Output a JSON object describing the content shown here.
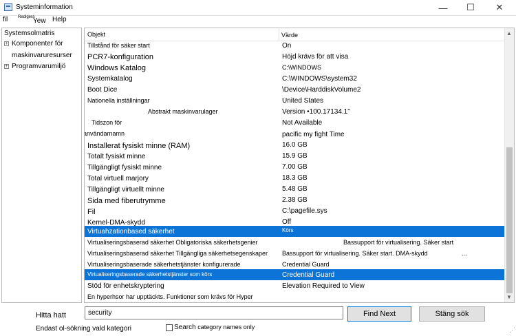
{
  "window": {
    "title": "Systeminformation",
    "minimize_glyph": "—",
    "maximize_glyph": "☐",
    "close_glyph": "✕"
  },
  "menu": {
    "file": "fil",
    "edit": "Redigera",
    "view": "Yew",
    "help": "Help"
  },
  "tree": {
    "root": "Systemsolmatris",
    "items": [
      "Komponenter för",
      "maskinvaruresurser",
      "Programvarumiljö"
    ]
  },
  "table": {
    "headers": {
      "item": "Objekt",
      "value": "Värde"
    },
    "rows": [
      {
        "item": "Tillstånd för säker start",
        "value": "On",
        "selected": false
      },
      {
        "item": "PCR7-konfiguration",
        "value": "Höjd krävs för att visa",
        "selected": false
      },
      {
        "item": "Windows Katalog",
        "value": "C:\\WINDOWS",
        "selected": false
      },
      {
        "item": "Systemkatalog",
        "value": "C:\\WINDOWS\\system32",
        "selected": false
      },
      {
        "item": "Boot Dice",
        "value": "\\Device\\HarddiskVolume2",
        "selected": false
      },
      {
        "item": "Nationella inställningar",
        "value": "United States",
        "selected": false
      },
      {
        "item": "Abstrakt maskinvarulager",
        "value": "Version •100.17134.1\"",
        "selected": false
      },
      {
        "item": "Tidszon för",
        "value": "Not Available",
        "selected": false
      },
      {
        "item": "användarnamn",
        "value": "pacific my fight Time",
        "selected": false
      },
      {
        "item": "Installerat fysiskt minne (RAM)",
        "value": "16.0 GB",
        "selected": false
      },
      {
        "item": "Totalt fysiskt minne",
        "value": "15.9 GB",
        "selected": false
      },
      {
        "item": "Tillgängligt fysiskt minne",
        "value": "7.00 GB",
        "selected": false
      },
      {
        "item": "Total virtuell marjory",
        "value": "18.3 GB",
        "selected": false
      },
      {
        "item": "Tillgängligt virtuellt minne",
        "value": "5.48 GB",
        "selected": false
      },
      {
        "item": "Sida med fiberutrymme",
        "value": "2.38 GB",
        "selected": false
      },
      {
        "item": "Fil",
        "value": "C:\\pagefile.sys",
        "selected": false
      },
      {
        "item": "Kernel-DMA-skydd",
        "value": "Off",
        "selected": false
      },
      {
        "item": "Virtuahzationbased säkerhet",
        "value": "Körs",
        "selected": true
      },
      {
        "item": "Virtualiseringsbaserad säkerhet Obligatoriska säkerhetsgenier",
        "value": "Bassupport för virtualisering. Säker start",
        "selected": false
      },
      {
        "item": "Virtualiseringsbaserad säkerhet Tillgängliga säkerhetsegenskaper",
        "value": "Bassupport för virtualisering. Säker start. DMA-skydd",
        "selected": false
      },
      {
        "item": "Virtualiseringsbaserade säkerhetstjänster konfigurerade",
        "value": "Credential Guard",
        "selected": false
      },
      {
        "item": "Virtualiseringsbaserade säkerhetstjänster som körs",
        "value": "Credential Guard",
        "selected": true
      },
      {
        "item": "Stöd för enhetskryptering",
        "value": "Elevation Required to View",
        "selected": false
      },
      {
        "item": "En hyperhsor har upptäckts. Funktioner som krävs för Hyper",
        "value": "",
        "selected": false
      }
    ],
    "overflow_ellipsis": "..."
  },
  "find": {
    "label": "Hitta hatt",
    "value": "security",
    "find_next": "Find Next",
    "close": "Stäng sök",
    "category_only": "Endast ol-sökning vald kategori",
    "search_names_label_a": "Search",
    "search_names_label_b": " category names only",
    "search_names_checked": false
  },
  "colors": {
    "selection": "#0d74d7",
    "window_bg": "#f0f0f0"
  }
}
